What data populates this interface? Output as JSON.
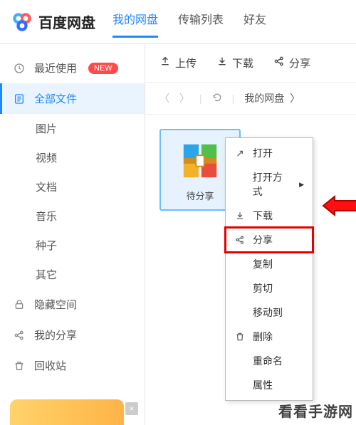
{
  "header": {
    "logo_text": "百度网盘",
    "tabs": [
      "我的网盘",
      "传输列表",
      "好友"
    ]
  },
  "sidebar": {
    "recent": "最近使用",
    "new_badge": "NEW",
    "all_files": "全部文件",
    "subs": [
      "图片",
      "视频",
      "文档",
      "音乐",
      "种子",
      "其它"
    ],
    "hidden": "隐藏空间",
    "my_share": "我的分享",
    "recycle": "回收站"
  },
  "toolbar": {
    "upload": "上传",
    "download": "下载",
    "share": "分享"
  },
  "navbar": {
    "crumb_root": "我的网盘"
  },
  "file": {
    "name": "待分享"
  },
  "context_menu": {
    "open": "打开",
    "open_with": "打开方式",
    "download": "下载",
    "share": "分享",
    "copy": "复制",
    "cut": "剪切",
    "move_to": "移动到",
    "delete": "删除",
    "rename": "重命名",
    "properties": "属性"
  },
  "watermark": "看看手游网",
  "colors": {
    "accent": "#1e88ff",
    "highlight": "#e60000"
  }
}
